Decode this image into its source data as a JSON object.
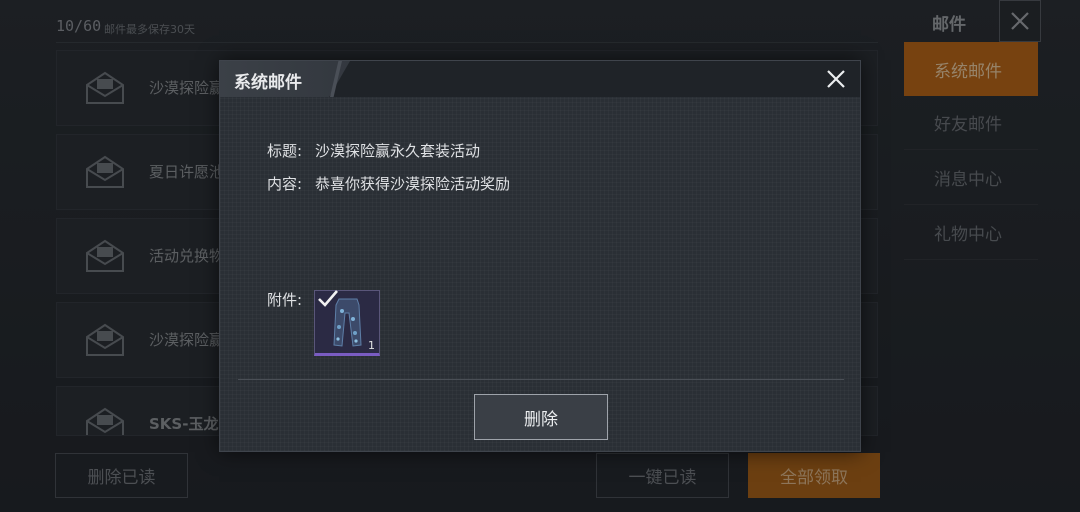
{
  "background": {
    "mail_count": "10/60",
    "mail_note": "邮件最多保存30天",
    "mail_rows": [
      {
        "subject": "沙漠探险赢"
      },
      {
        "subject": "夏日许愿池"
      },
      {
        "subject": "活动兑换物"
      },
      {
        "subject": "沙漠探险赢"
      },
      {
        "subject": "SKS-玉龙"
      }
    ],
    "side_title": "邮件",
    "side_tabs": [
      "系统邮件",
      "好友邮件",
      "消息中心",
      "礼物中心"
    ],
    "active_tab_color": "#b7661a",
    "buttons": {
      "delete_read": "删除已读",
      "mark_all_read": "一键已读",
      "claim_all": "全部领取"
    }
  },
  "dialog": {
    "title": "系统邮件",
    "subject_label": "标题:",
    "subject_value": "沙漠探险赢永久套装活动",
    "content_label": "内容:",
    "content_value": "恭喜你获得沙漠探险活动奖励",
    "attachment_label": "附件:",
    "attachment": {
      "icon": "camo-pants-icon",
      "count": "1",
      "claimed": true
    },
    "delete_button": "删除"
  }
}
